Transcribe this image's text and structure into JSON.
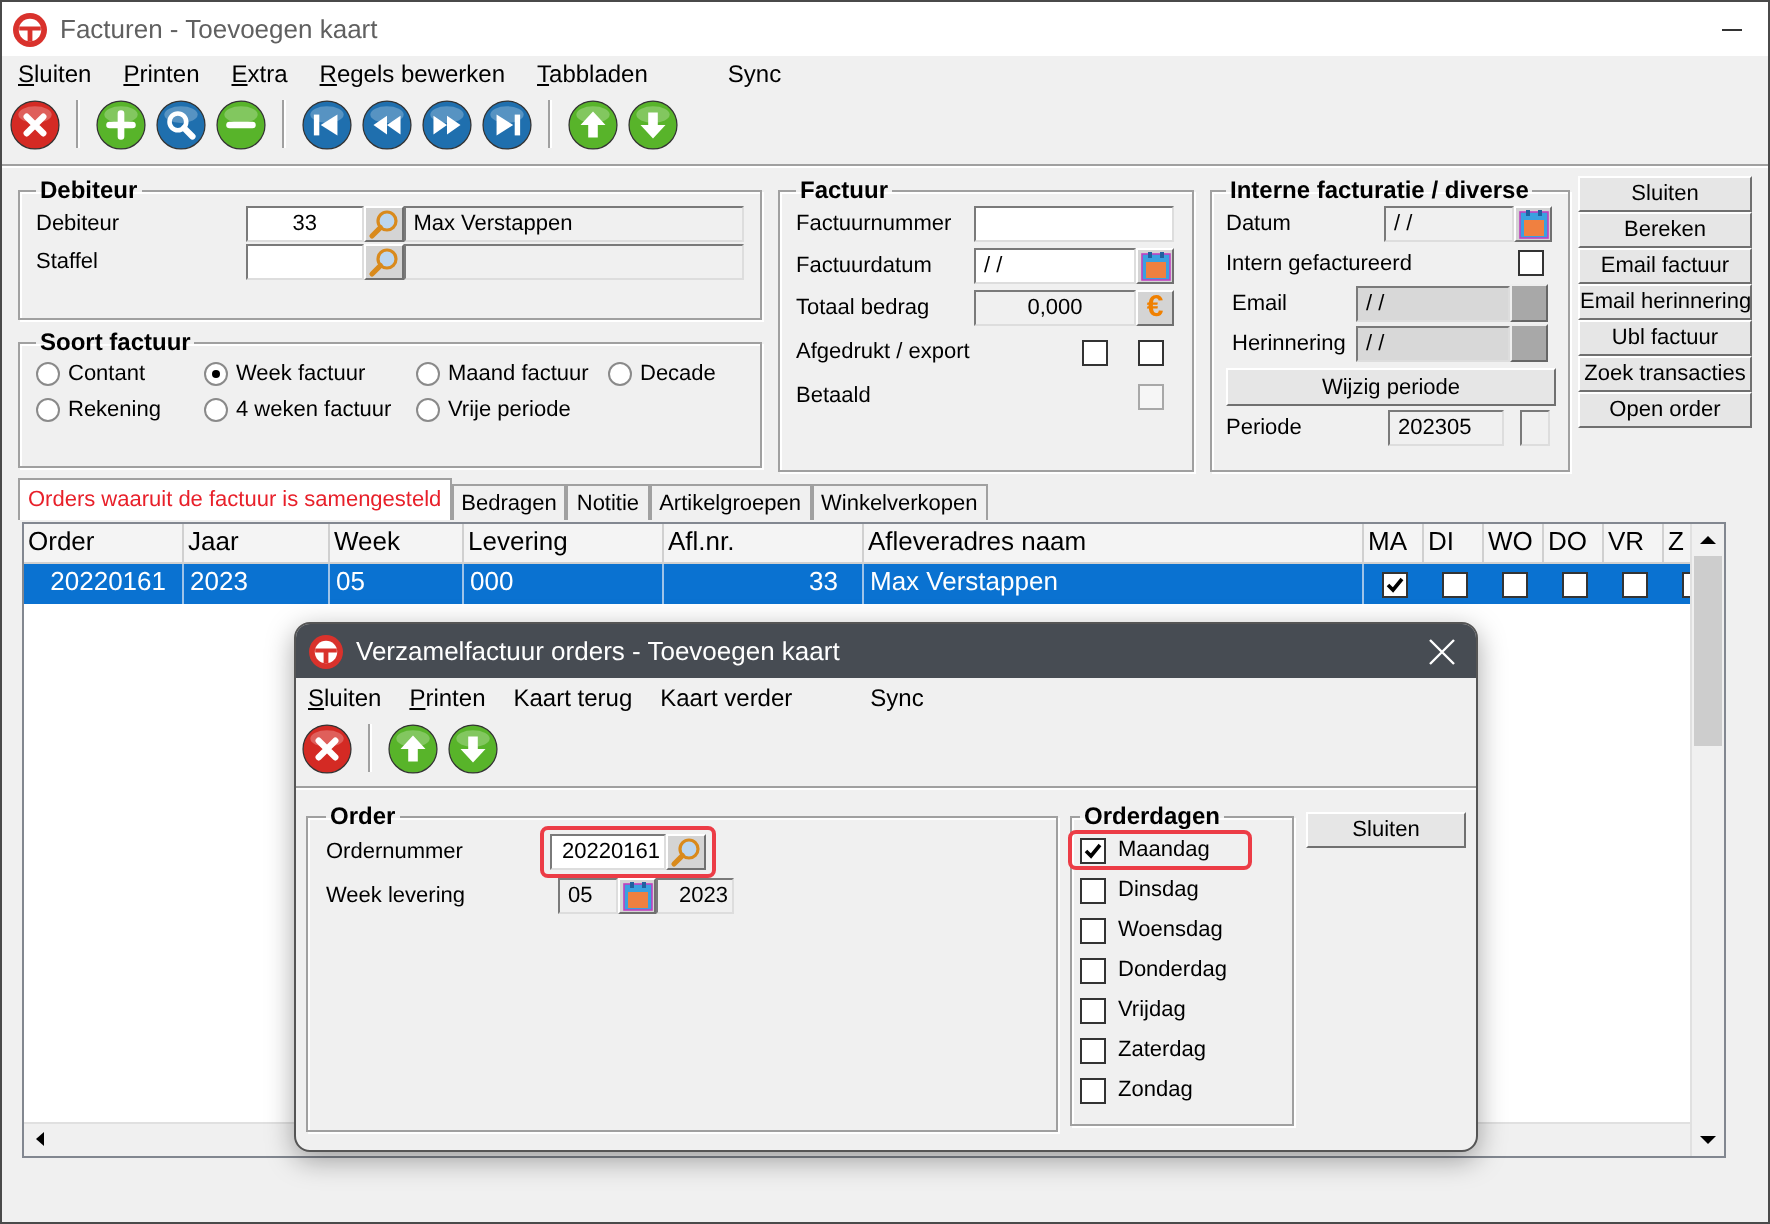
{
  "window": {
    "title": "Facturen - Toevoegen kaart"
  },
  "menu": [
    {
      "label": "Sluiten",
      "access_key": true
    },
    {
      "label": "Printen",
      "access_key": true
    },
    {
      "label": "Extra",
      "access_key": true
    },
    {
      "label": "Regels bewerken",
      "access_key": true
    },
    {
      "label": "Tabbladen",
      "access_key": true
    },
    {
      "label": "Sync",
      "access_key": false
    }
  ],
  "toolbar": [
    {
      "kind": "close"
    },
    {
      "kind": "separator"
    },
    {
      "kind": "add"
    },
    {
      "kind": "search"
    },
    {
      "kind": "remove"
    },
    {
      "kind": "separator"
    },
    {
      "kind": "first"
    },
    {
      "kind": "previous"
    },
    {
      "kind": "next"
    },
    {
      "kind": "last"
    },
    {
      "kind": "separator"
    },
    {
      "kind": "up"
    },
    {
      "kind": "down"
    }
  ],
  "debiteur": {
    "title": "Debiteur",
    "rows": [
      {
        "label": "Debiteur",
        "value": "33",
        "name": "Max Verstappen"
      },
      {
        "label": "Staffel"
      }
    ]
  },
  "soort_factuur": {
    "title": "Soort factuur",
    "options": [
      {
        "label": "Contant",
        "selected": false
      },
      {
        "label": "Week factuur",
        "selected": true
      },
      {
        "label": "Maand factuur",
        "selected": false
      },
      {
        "label": "Decade",
        "selected": false
      },
      {
        "label": "Rekening",
        "selected": false
      },
      {
        "label": "4 weken factuur",
        "selected": false
      },
      {
        "label": "Vrije periode",
        "selected": false
      }
    ]
  },
  "factuur": {
    "title": "Factuur",
    "fields": [
      {
        "kind": "text",
        "label": "Factuurnummer"
      },
      {
        "kind": "date",
        "label": "Factuurdatum",
        "value": "/ /"
      },
      {
        "kind": "amount",
        "label": "Totaal bedrag",
        "value": "0,000",
        "button": "€"
      }
    ],
    "checks": [
      {
        "label": "Afgedrukt / export",
        "boxes": [
          {
            "checked": false,
            "disabled": false
          },
          {
            "checked": false,
            "disabled": false
          }
        ]
      },
      {
        "label": "Betaald",
        "boxes": [
          {
            "checked": false,
            "disabled": true
          }
        ]
      }
    ]
  },
  "interne": {
    "title": "Interne facturatie / diverse",
    "datum": {
      "label": "Datum",
      "value": "/ /"
    },
    "intern": {
      "label": "Intern gefactureerd",
      "checked": false
    },
    "email": {
      "label": "Email",
      "value": "/ /"
    },
    "herinnering": {
      "label": "Herinnering",
      "value": "/ /"
    },
    "wijzig_button": "Wijzig periode",
    "periode": {
      "label": "Periode",
      "value": "202305"
    }
  },
  "side_buttons": [
    "Sluiten",
    "Bereken",
    "Email factuur",
    "Email herinnering",
    "Ubl factuur",
    "Zoek transacties",
    "Open order"
  ],
  "tabs": [
    {
      "label": "Orders waaruit de factuur is samengesteld",
      "selected": true
    },
    {
      "label": "Bedragen",
      "selected": false
    },
    {
      "label": "Notitie",
      "selected": false
    },
    {
      "label": "Artikelgroepen",
      "selected": false
    },
    {
      "label": "Winkelverkopen",
      "selected": false
    }
  ],
  "orders": {
    "columns": [
      "Order",
      "Jaar",
      "Week",
      "Levering",
      "Afl.nr.",
      "Afleveradres naam",
      "MA",
      "DI",
      "WO",
      "DO",
      "VR",
      "Z"
    ],
    "rows": [
      {
        "selected": true,
        "cells": [
          "20220161",
          "2023",
          "05",
          "000",
          "33",
          "Max Verstappen"
        ],
        "days": [
          true,
          false,
          false,
          false,
          false,
          false
        ]
      }
    ]
  },
  "dialog": {
    "title": "Verzamelfactuur orders - Toevoegen kaart",
    "menu": [
      {
        "label": "Sluiten",
        "access_key": true
      },
      {
        "label": "Printen",
        "access_key": true
      },
      {
        "label": "Kaart terug",
        "access_key": false
      },
      {
        "label": "Kaart verder",
        "access_key": false
      },
      {
        "label": "Sync",
        "access_key": false
      }
    ],
    "toolbar": [
      {
        "kind": "close"
      },
      {
        "kind": "separator"
      },
      {
        "kind": "up"
      },
      {
        "kind": "down"
      }
    ],
    "order": {
      "title": "Order",
      "ordernummer": {
        "label": "Ordernummer",
        "value": "20220161",
        "highlighted": true
      },
      "week_levering": {
        "label": "Week levering",
        "week": "05",
        "year": "2023"
      }
    },
    "orderdagen": {
      "title": "Orderdagen",
      "days": [
        {
          "label": "Maandag",
          "checked": true,
          "highlighted": true
        },
        {
          "label": "Dinsdag",
          "checked": false,
          "highlighted": false
        },
        {
          "label": "Woensdag",
          "checked": false,
          "highlighted": false
        },
        {
          "label": "Donderdag",
          "checked": false,
          "highlighted": false
        },
        {
          "label": "Vrijdag",
          "checked": false,
          "highlighted": false
        },
        {
          "label": "Zaterdag",
          "checked": false,
          "highlighted": false
        },
        {
          "label": "Zondag",
          "checked": false,
          "highlighted": false
        }
      ]
    },
    "close_button": "Sluiten"
  }
}
